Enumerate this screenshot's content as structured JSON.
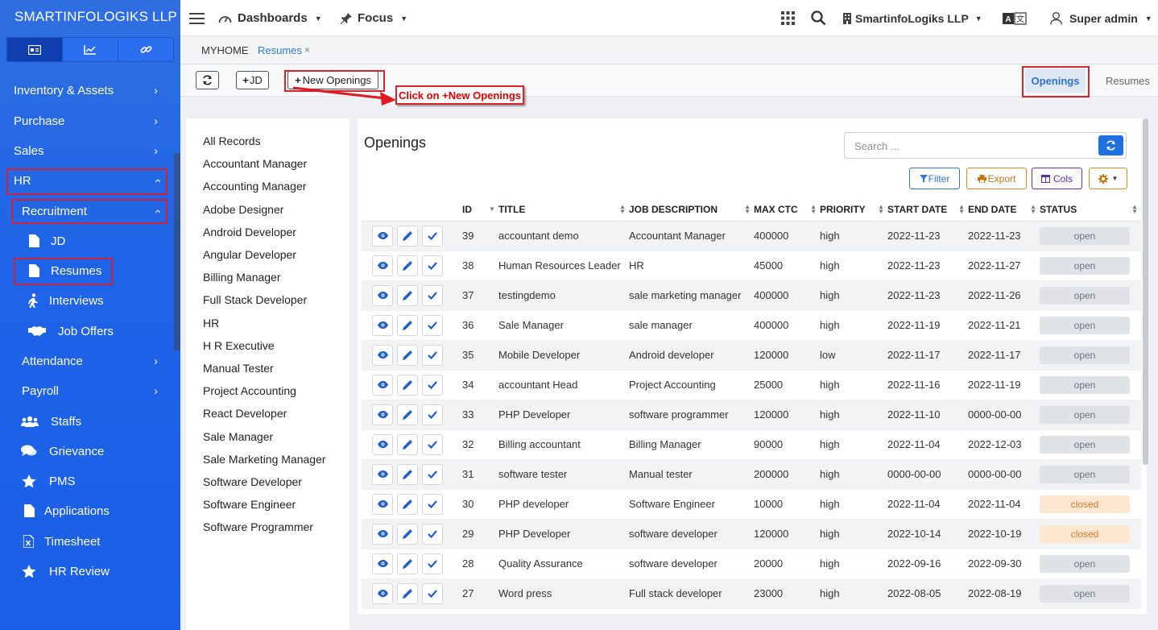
{
  "brand": "SMARTINFOLOGIKS LLP",
  "module_tabs": [
    {
      "icon": "id-card-icon"
    },
    {
      "icon": "chart-line-icon"
    },
    {
      "icon": "link-icon"
    }
  ],
  "sidebar": {
    "inventory": "Inventory & Assets",
    "purchase": "Purchase",
    "sales": "Sales",
    "hr": "HR",
    "recruitment": "Recruitment",
    "jd": "JD",
    "resumes": "Resumes",
    "interviews": "Interviews",
    "job_offers": "Job Offers",
    "attendance": "Attendance",
    "payroll": "Payroll",
    "staffs": "Staffs",
    "grievance": "Grievance",
    "pms": "PMS",
    "applications": "Applications",
    "timesheet": "Timesheet",
    "hr_review": "HR Review"
  },
  "topbar": {
    "dashboards": "Dashboards",
    "focus": "Focus",
    "company": "SmartinfoLogiks LLP",
    "user": "Super admin"
  },
  "breadcrumb": {
    "home": "MYHOME",
    "current": "Resumes",
    "close": "×"
  },
  "actions": {
    "jd": "JD",
    "new_openings": "New Openings",
    "openings_tab": "Openings",
    "resumes_tab": "Resumes"
  },
  "callout": "Click on +New Openings",
  "categories": [
    "All Records",
    "Accountant Manager",
    "Accounting Manager",
    "Adobe Designer",
    "Android Developer",
    "Angular Developer",
    "Billing Manager",
    "Full Stack Developer",
    "HR",
    "H R Executive",
    "Manual Tester",
    "Project Accounting",
    "React Developer",
    "Sale Manager",
    "Sale Marketing Manager",
    "Software Developer",
    "Software Engineer",
    "Software Programmer"
  ],
  "openings": {
    "title": "Openings",
    "search_placeholder": "Search ...",
    "filter": "Filter",
    "export": "Export",
    "cols": "Cols",
    "columns": [
      "ID",
      "TITLE",
      "JOB DESCRIPTION",
      "MAX CTC",
      "PRIORITY",
      "START DATE",
      "END DATE",
      "STATUS"
    ],
    "rows": [
      {
        "id": "39",
        "title": "accountant demo",
        "desc": "Accountant Manager",
        "ctc": "400000",
        "priority": "high",
        "start": "2022-11-23",
        "end": "2022-11-23",
        "status": "open"
      },
      {
        "id": "38",
        "title": "Human Resources Leader",
        "desc": "HR",
        "ctc": "45000",
        "priority": "high",
        "start": "2022-11-23",
        "end": "2022-11-27",
        "status": "open"
      },
      {
        "id": "37",
        "title": "testingdemo",
        "desc": "sale marketing manager",
        "ctc": "400000",
        "priority": "high",
        "start": "2022-11-23",
        "end": "2022-11-26",
        "status": "open"
      },
      {
        "id": "36",
        "title": "Sale Manager",
        "desc": "sale manager",
        "ctc": "400000",
        "priority": "high",
        "start": "2022-11-19",
        "end": "2022-11-21",
        "status": "open"
      },
      {
        "id": "35",
        "title": "Mobile Developer",
        "desc": "Android developer",
        "ctc": "120000",
        "priority": "low",
        "start": "2022-11-17",
        "end": "2022-11-17",
        "status": "open"
      },
      {
        "id": "34",
        "title": "accountant Head",
        "desc": "Project Accounting",
        "ctc": "25000",
        "priority": "high",
        "start": "2022-11-16",
        "end": "2022-11-19",
        "status": "open"
      },
      {
        "id": "33",
        "title": "PHP Developer",
        "desc": "software programmer",
        "ctc": "120000",
        "priority": "high",
        "start": "2022-11-10",
        "end": "0000-00-00",
        "status": "open"
      },
      {
        "id": "32",
        "title": "Billing accountant",
        "desc": "Billing Manager",
        "ctc": "90000",
        "priority": "high",
        "start": "2022-11-04",
        "end": "2022-12-03",
        "status": "open"
      },
      {
        "id": "31",
        "title": "software tester",
        "desc": "Manual tester",
        "ctc": "200000",
        "priority": "high",
        "start": "0000-00-00",
        "end": "0000-00-00",
        "status": "open"
      },
      {
        "id": "30",
        "title": "PHP developer",
        "desc": "Software Engineer",
        "ctc": "10000",
        "priority": "high",
        "start": "2022-11-04",
        "end": "2022-11-04",
        "status": "closed"
      },
      {
        "id": "29",
        "title": "PHP Developer",
        "desc": "software developer",
        "ctc": "120000",
        "priority": "high",
        "start": "2022-10-14",
        "end": "2022-10-19",
        "status": "closed"
      },
      {
        "id": "28",
        "title": "Quality Assurance",
        "desc": "software developer",
        "ctc": "20000",
        "priority": "high",
        "start": "2022-09-16",
        "end": "2022-09-30",
        "status": "open"
      },
      {
        "id": "27",
        "title": "Word press",
        "desc": "Full stack developer",
        "ctc": "23000",
        "priority": "high",
        "start": "2022-08-05",
        "end": "2022-08-19",
        "status": "open"
      }
    ]
  },
  "colors": {
    "sidebar": "#1e63e8",
    "accent": "#1f6fe0",
    "highlight": "#d8232a",
    "closed_bg": "#fde7d0",
    "open_bg": "#dfe2e6"
  }
}
